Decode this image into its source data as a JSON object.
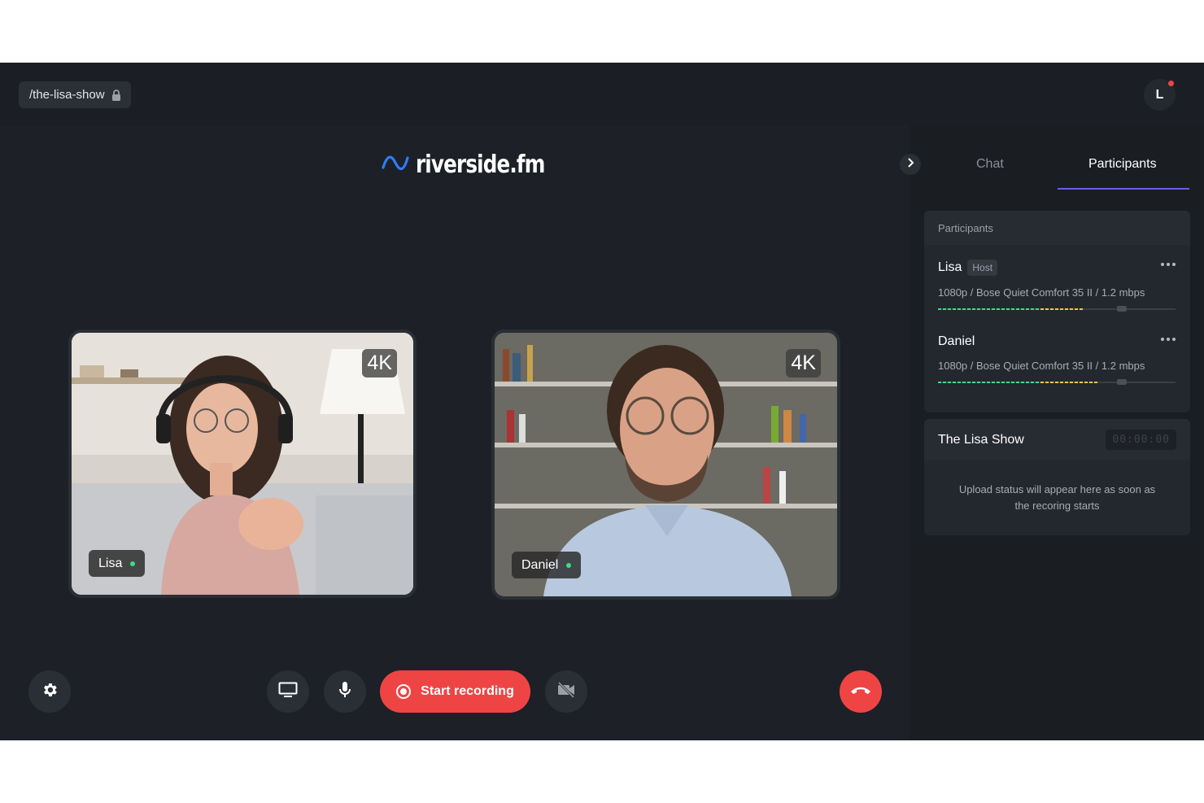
{
  "topbar": {
    "room_slug": "/the-lisa-show",
    "avatar_initial": "L"
  },
  "logo": {
    "text": "riverside.fm",
    "icon": "wave-icon"
  },
  "tiles": [
    {
      "name": "Lisa",
      "quality": "4K",
      "status_color": "#3ddc84"
    },
    {
      "name": "Daniel",
      "quality": "4K",
      "status_color": "#3ddc84"
    }
  ],
  "controls": {
    "settings_icon": "gear-icon",
    "screen_icon": "monitor-icon",
    "mic_icon": "microphone-icon",
    "record_label": "Start recording",
    "camera_icon": "camera-off-icon",
    "hangup_icon": "phone-hangup-icon",
    "accent": "#ef4444"
  },
  "sidebar": {
    "tabs": [
      {
        "label": "Chat",
        "active": false
      },
      {
        "label": "Participants",
        "active": true
      }
    ],
    "participants_header": "Participants",
    "participants": [
      {
        "name": "Lisa",
        "role": "Host",
        "info": "1080p / Bose Quiet Comfort 35 II / 1.2 mbps",
        "level": 0.6
      },
      {
        "name": "Daniel",
        "role": "",
        "info": "1080p / Bose Quiet Comfort 35 II / 1.2 mbps",
        "level": 0.66
      }
    ],
    "show": {
      "title": "The Lisa Show",
      "timer": "00:00:00",
      "upload_status": "Upload status will appear here as soon as the recoring starts"
    }
  }
}
